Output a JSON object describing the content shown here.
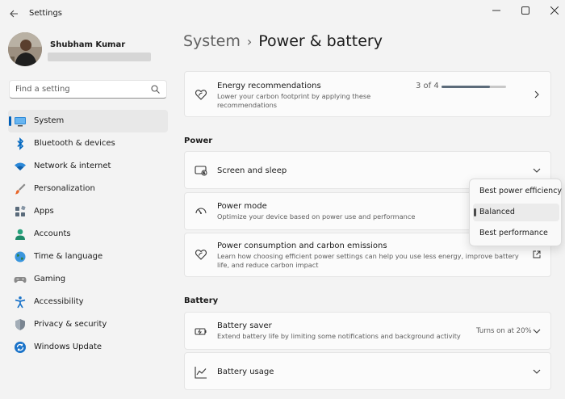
{
  "window": {
    "title": "Settings",
    "back_icon": "back-arrow-icon",
    "controls": [
      "minimize-icon",
      "maximize-icon",
      "close-icon"
    ]
  },
  "profile": {
    "name": "Shubham Kumar"
  },
  "search": {
    "placeholder": "Find a setting",
    "value": ""
  },
  "sidebar": {
    "items": [
      {
        "label": "System",
        "icon": "system-icon",
        "active": true
      },
      {
        "label": "Bluetooth & devices",
        "icon": "bluetooth-icon"
      },
      {
        "label": "Network & internet",
        "icon": "wifi-icon"
      },
      {
        "label": "Personalization",
        "icon": "brush-icon"
      },
      {
        "label": "Apps",
        "icon": "apps-icon"
      },
      {
        "label": "Accounts",
        "icon": "person-icon"
      },
      {
        "label": "Time & language",
        "icon": "globe-icon"
      },
      {
        "label": "Gaming",
        "icon": "gamepad-icon"
      },
      {
        "label": "Accessibility",
        "icon": "accessibility-icon"
      },
      {
        "label": "Privacy & security",
        "icon": "shield-icon"
      },
      {
        "label": "Windows Update",
        "icon": "update-icon"
      }
    ]
  },
  "header": {
    "crumb": "System",
    "separator": "›",
    "current": "Power & battery"
  },
  "energy": {
    "title": "Energy recommendations",
    "desc": "Lower your carbon footprint by applying these recommendations",
    "progress_text": "3 of 4",
    "progress": 0.75,
    "icon": "leaf-heart-icon"
  },
  "power_section": {
    "title": "Power"
  },
  "screen_sleep": {
    "title": "Screen and sleep",
    "icon": "screen-sleep-icon"
  },
  "power_mode": {
    "title": "Power mode",
    "desc": "Optimize your device based on power use and performance",
    "icon": "gauge-icon",
    "options": [
      "Best power efficiency",
      "Balanced",
      "Best performance"
    ],
    "selected": "Balanced"
  },
  "power_consumption": {
    "title": "Power consumption and carbon emissions",
    "desc": "Learn how choosing efficient power settings can help you use less energy, improve battery life, and reduce carbon impact",
    "icon": "leaf-heart-icon",
    "action_icon": "open-external-icon"
  },
  "battery_section": {
    "title": "Battery"
  },
  "battery_saver": {
    "title": "Battery saver",
    "desc": "Extend battery life by limiting some notifications and background activity",
    "status": "Turns on at 20%",
    "icon": "battery-saver-icon"
  },
  "battery_usage": {
    "title": "Battery usage",
    "icon": "chart-line-icon"
  },
  "colors": {
    "accent": "#005fb8",
    "background": "#f3f3f3",
    "card": "#fbfbfb"
  }
}
